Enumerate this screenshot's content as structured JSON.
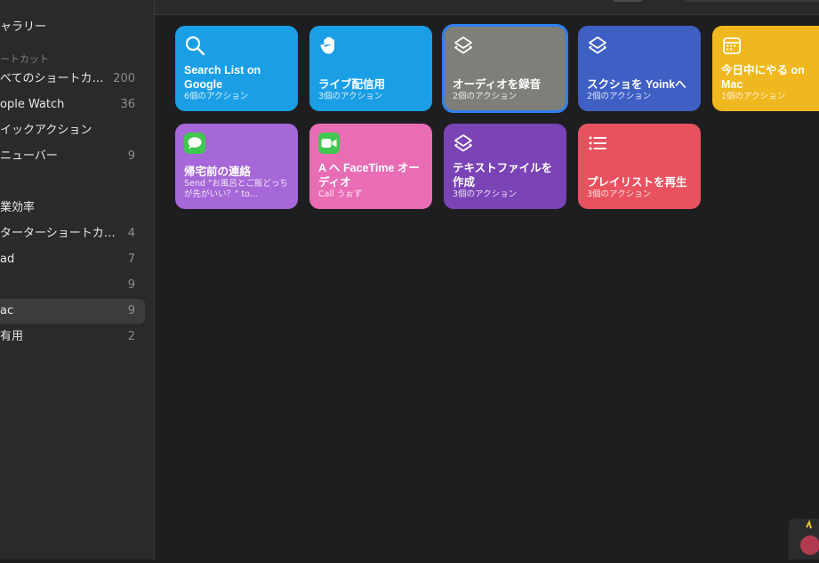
{
  "sidebar": {
    "items": [
      {
        "label": "ャラリー",
        "count": ""
      },
      {
        "label": "ートカット",
        "count": "",
        "section": true
      },
      {
        "label": "べてのショートカ…",
        "count": "200"
      },
      {
        "label": "ople Watch",
        "count": "36"
      },
      {
        "label": "イックアクション",
        "count": ""
      },
      {
        "label": "ニューバー",
        "count": "9"
      },
      {
        "label": "業効率",
        "count": ""
      },
      {
        "label": "ターターショートカット",
        "count": "4"
      },
      {
        "label": "ad",
        "count": "7"
      },
      {
        "label": "",
        "count": "9"
      },
      {
        "label": "ac",
        "count": "9",
        "selected": true
      },
      {
        "label": "有用",
        "count": "2"
      }
    ]
  },
  "shortcuts": [
    {
      "title": "Search List on Google",
      "sub": "6個のアクション",
      "color": "#1a9fe6",
      "icon": "magnifier-icon"
    },
    {
      "title": "ライブ配信用",
      "sub": "3個のアクション",
      "color": "#1a9fe6",
      "icon": "hand-icon"
    },
    {
      "title": "オーディオを録音",
      "sub": "2個のアクション",
      "color": "#7e7f78",
      "icon": "layers-icon",
      "selected": true
    },
    {
      "title": "スクショを Yoinkへ",
      "sub": "2個のアクション",
      "color": "#3f5fc4",
      "icon": "layers-icon"
    },
    {
      "title": "今日中にやる on Mac",
      "sub": "1個のアクション",
      "color": "#f0b81f",
      "icon": "calendar-icon"
    },
    {
      "title": "帰宅前の連絡",
      "sub": "Send \"お風呂とご飯どっちが先がいい？\" to...",
      "color": "#a667d8",
      "icon": "messages-app-icon"
    },
    {
      "title": "A へ FaceTime オーディオ",
      "sub": "Call うぉず",
      "color": "#e86db4",
      "icon": "facetime-app-icon"
    },
    {
      "title": "テキストファイルを作成",
      "sub": "3個のアクション",
      "color": "#7a43b6",
      "icon": "layers-icon"
    },
    {
      "title": "プレイリストを再生",
      "sub": "3個のアクション",
      "color": "#e8525f",
      "icon": "list-icon"
    }
  ]
}
